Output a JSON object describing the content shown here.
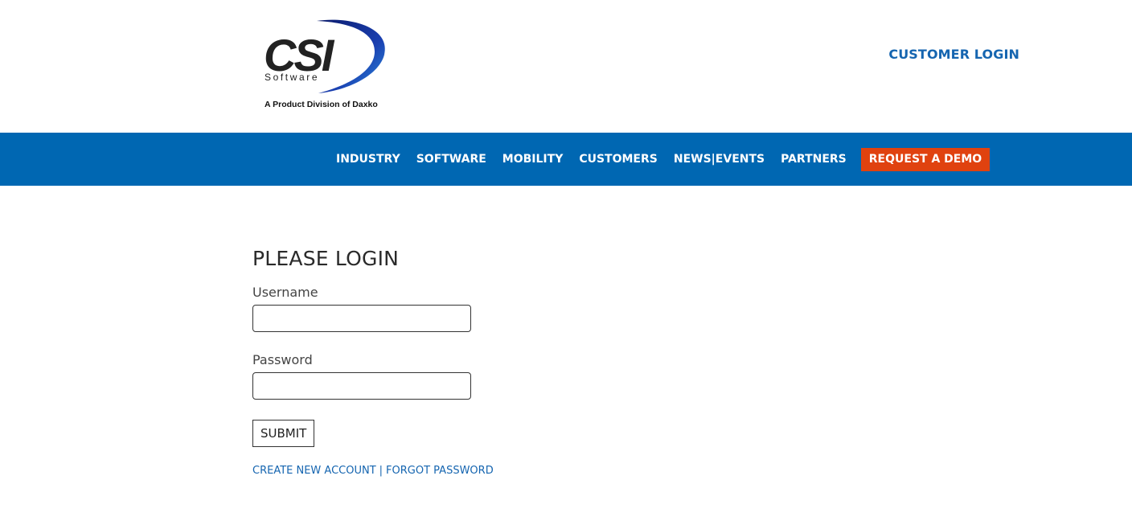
{
  "header": {
    "logo_text": "CSI",
    "logo_subtext": "Software",
    "logo_tagline": "A Product Division of Daxko",
    "customer_login": "CUSTOMER LOGIN"
  },
  "nav": {
    "items": [
      {
        "label": "INDUSTRY"
      },
      {
        "label": "SOFTWARE"
      },
      {
        "label": "MOBILITY"
      },
      {
        "label": "CUSTOMERS"
      },
      {
        "label": "NEWS|EVENTS"
      },
      {
        "label": "PARTNERS"
      }
    ],
    "demo_button": "REQUEST A DEMO"
  },
  "login": {
    "title": "PLEASE LOGIN",
    "username_label": "Username",
    "username_value": "",
    "password_label": "Password",
    "password_value": "",
    "submit_label": "SUBMIT",
    "create_account": "CREATE NEW ACCOUNT",
    "separator": "|",
    "forgot_password": "FORGOT PASSWORD"
  },
  "colors": {
    "brand_blue": "#0067b2",
    "link_blue": "#1565b0",
    "demo_orange": "#e0420f"
  }
}
